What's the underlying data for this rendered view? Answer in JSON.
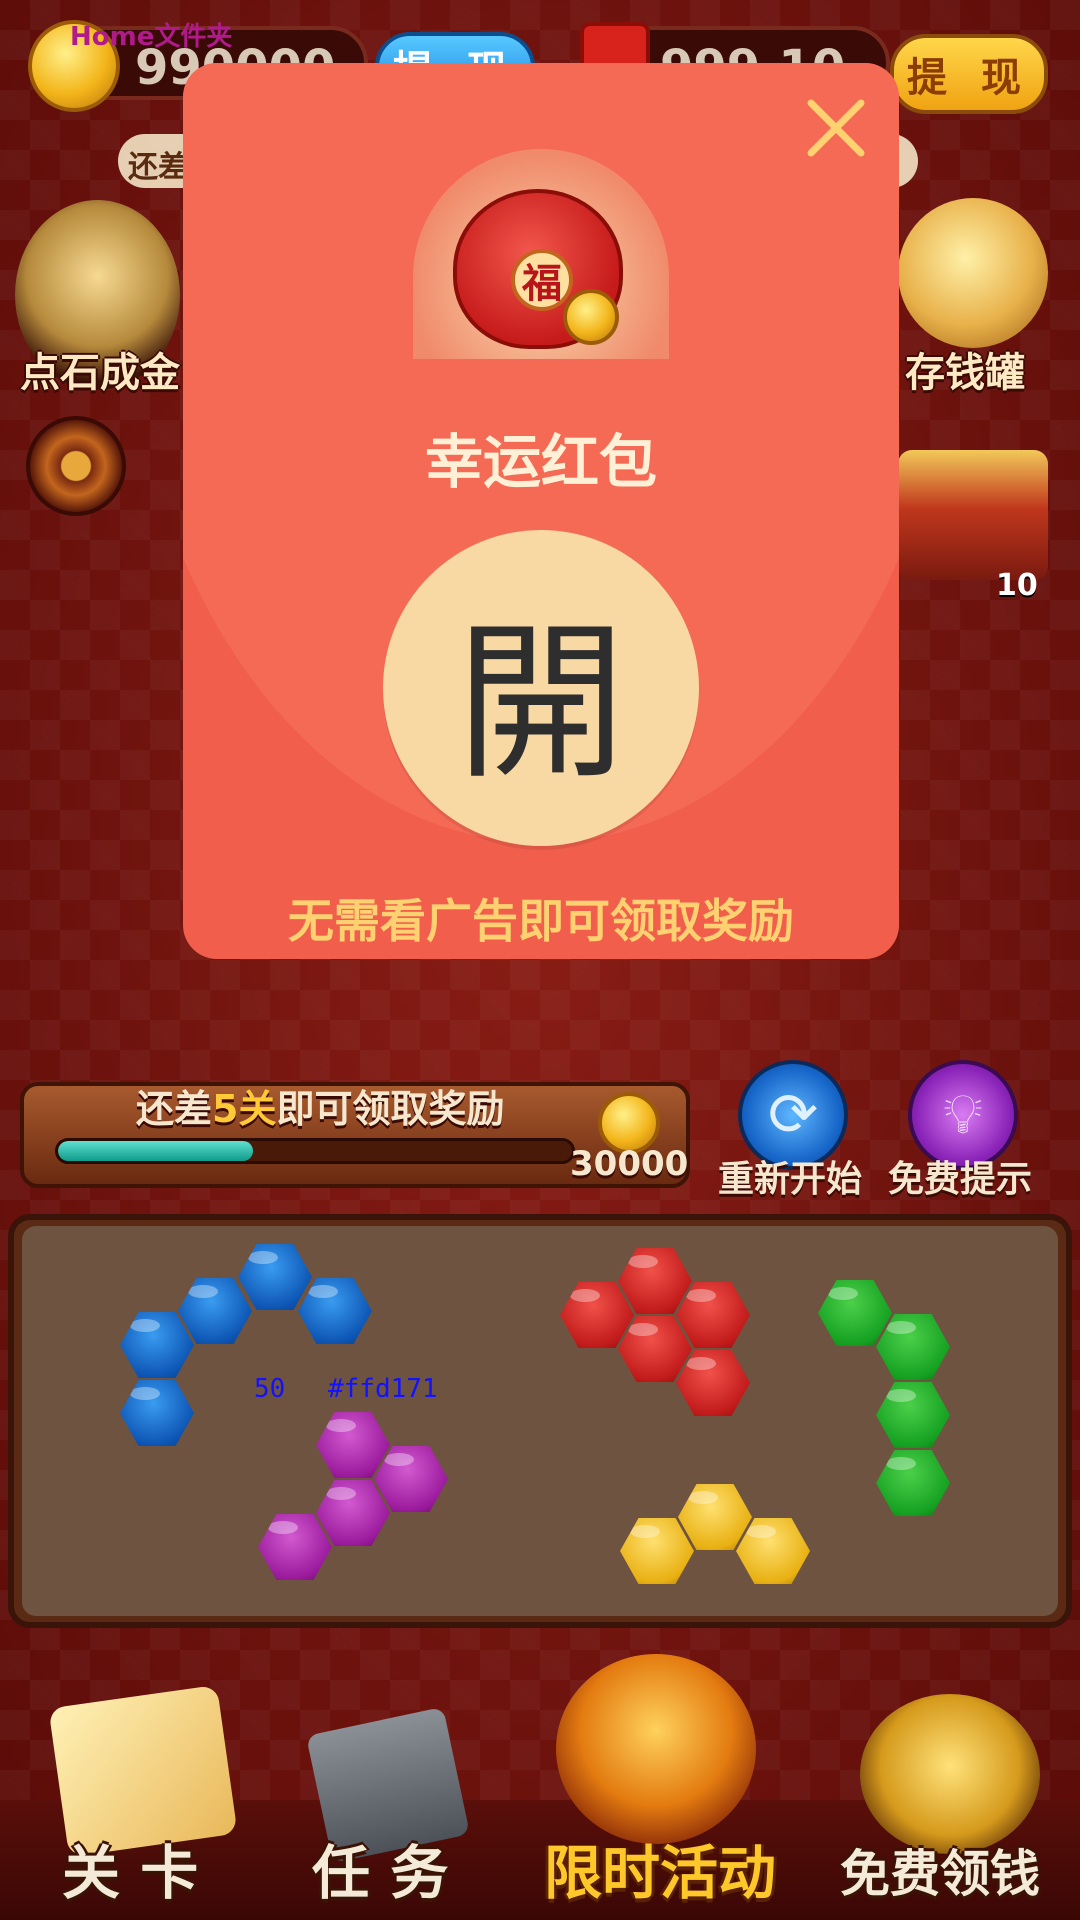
{
  "watermark": "Home文件夹",
  "top_bar": {
    "coins_value": "990000",
    "withdraw_left_label": "提 现",
    "cash_value": "999.10",
    "withdraw_right_label": "提 现",
    "hint_partial": "还差"
  },
  "side": {
    "left_feature_label": "点石成金",
    "right_feature_label": "存钱罐",
    "chest_count": "10"
  },
  "popup": {
    "title": "幸运红包",
    "open_label": "開",
    "footer": "无需看广告即可领取奖励",
    "bag_char": "福"
  },
  "progress": {
    "prefix": "还差",
    "levels": "5关",
    "suffix": "即可领取奖励",
    "reward": "30000",
    "fill_fraction": 0.38
  },
  "actions": {
    "restart_label": "重新开始",
    "hint_label": "免费提示"
  },
  "debug_overlay": {
    "number": "50",
    "color": "#ffd171"
  },
  "bottom_nav": {
    "items": [
      {
        "label": "关 卡"
      },
      {
        "label": "任 务"
      },
      {
        "label": "限时活动"
      },
      {
        "label": "免费领钱"
      }
    ]
  }
}
